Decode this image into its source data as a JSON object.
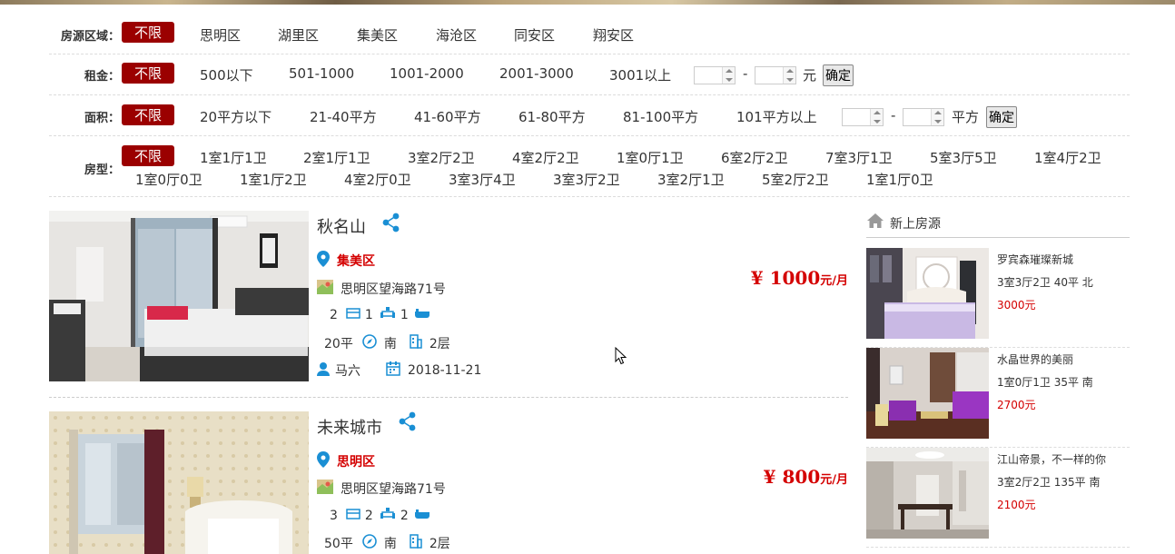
{
  "filters": {
    "region": {
      "label": "房源区域：",
      "options": [
        "不限",
        "思明区",
        "湖里区",
        "集美区",
        "海沧区",
        "同安区",
        "翔安区"
      ]
    },
    "rent": {
      "label": "租金：",
      "options": [
        "不限",
        "500以下",
        "501-1000",
        "1001-2000",
        "2001-3000",
        "3001以上"
      ],
      "unit": "元",
      "dash": "-",
      "confirm": "确定"
    },
    "area": {
      "label": "面积：",
      "options": [
        "不限",
        "20平方以下",
        "21-40平方",
        "41-60平方",
        "61-80平方",
        "81-100平方",
        "101平方以上"
      ],
      "unit": "平方",
      "dash": "-",
      "confirm": "确定"
    },
    "layout": {
      "label": "房型：",
      "options": [
        "不限",
        "1室1厅1卫",
        "2室1厅1卫",
        "3室2厅2卫",
        "4室2厅2卫",
        "1室0厅1卫",
        "6室2厅2卫",
        "7室3厅1卫",
        "5室3厅5卫",
        "1室4厅2卫",
        "1室0厅0卫",
        "1室1厅2卫",
        "4室2厅0卫",
        "3室3厅4卫",
        "3室3厅2卫",
        "3室2厅1卫",
        "5室2厅2卫",
        "1室1厅0卫"
      ]
    }
  },
  "listings": [
    {
      "title": "秋名山",
      "district": "集美区",
      "address": "思明区望海路71号",
      "rooms": "2",
      "halls": "1",
      "baths": "1",
      "area": "20平",
      "orientation": "南",
      "floor": "2层",
      "owner": "马六",
      "date": "2018-11-21",
      "price_symbol": "¥",
      "price": "1000",
      "price_unit": "元/月"
    },
    {
      "title": "未来城市",
      "district": "思明区",
      "address": "思明区望海路71号",
      "rooms": "3",
      "halls": "2",
      "baths": "2",
      "area": "50平",
      "orientation": "南",
      "floor": "2层",
      "price_symbol": "¥",
      "price": "800",
      "price_unit": "元/月"
    }
  ],
  "sidebar": {
    "title": "新上房源",
    "items": [
      {
        "name": "罗宾森璀璨新城",
        "desc": "3室3厅2卫 40平 北",
        "price": "3000元"
      },
      {
        "name": "水晶世界的美丽",
        "desc": "1室0厅1卫 35平 南",
        "price": "2700元"
      },
      {
        "name": "江山帝景，不一样的你",
        "desc": "3室2厅2卫 135平 南",
        "price": "2100元"
      }
    ]
  },
  "colors": {
    "accent": "#9b0000",
    "price": "#d40000",
    "icon": "#1a8fd4"
  }
}
